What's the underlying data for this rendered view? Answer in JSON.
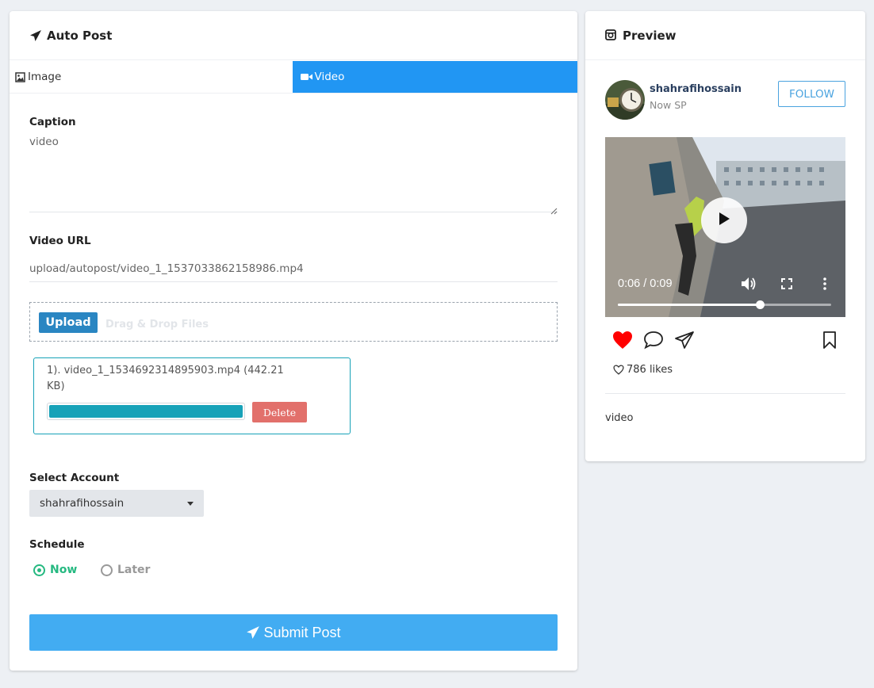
{
  "auto_post": {
    "title": "Auto Post",
    "tabs": [
      {
        "label": "Image",
        "active": false,
        "icon": "image-icon"
      },
      {
        "label": "Video",
        "active": true,
        "icon": "video-camera-icon"
      }
    ],
    "caption": {
      "label": "Caption",
      "value": "video"
    },
    "video_url": {
      "label": "Video URL",
      "value": "upload/autopost/video_1_1537033862158986.mp4"
    },
    "upload": {
      "button_label": "Upload",
      "dropzone_text": "Drag & Drop Files"
    },
    "file": {
      "name": "1). video_1_1534692314895903.mp4 (442.21 KB)",
      "progress": 1.0,
      "delete_label": "Delete"
    },
    "account": {
      "label": "Select Account",
      "selected": "shahrafihossain"
    },
    "schedule": {
      "label": "Schedule",
      "options": [
        {
          "label": "Now",
          "checked": true
        },
        {
          "label": "Later",
          "checked": false
        }
      ]
    },
    "submit_label": "Submit Post"
  },
  "preview": {
    "title": "Preview",
    "username": "shahrafihossain",
    "location": "Now SP",
    "follow_label": "FOLLOW",
    "video": {
      "time": "0:06 / 0:09",
      "progress": 0.667
    },
    "likes": "786 likes",
    "caption": "video"
  },
  "colors": {
    "accent": "#2196f3",
    "submit": "#42acf2",
    "success": "#26b981",
    "danger": "#e2706b",
    "info": "#17a2b8",
    "like": "#ff0000"
  }
}
